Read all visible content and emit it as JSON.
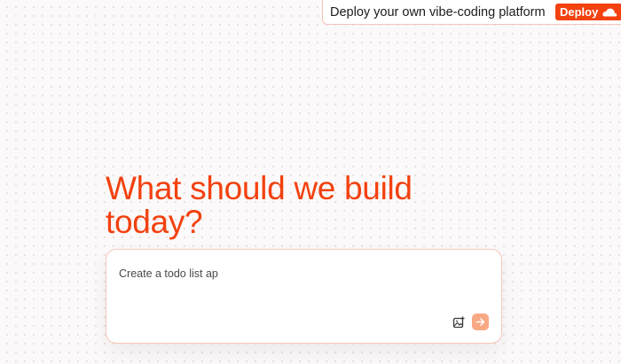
{
  "banner": {
    "text": "Deploy your own vibe-coding platform",
    "deploy_label": "Deploy",
    "deploy_icon": "cloudflare-cloud-icon"
  },
  "hero": {
    "heading": "What should we build today?"
  },
  "prompt": {
    "value": "Create a todo list ap",
    "image_icon": "image-upload-icon",
    "send_icon": "arrow-right-icon"
  },
  "colors": {
    "accent": "#f3410f",
    "send_button": "#f9a886",
    "card_border": "#f6c7b7"
  }
}
